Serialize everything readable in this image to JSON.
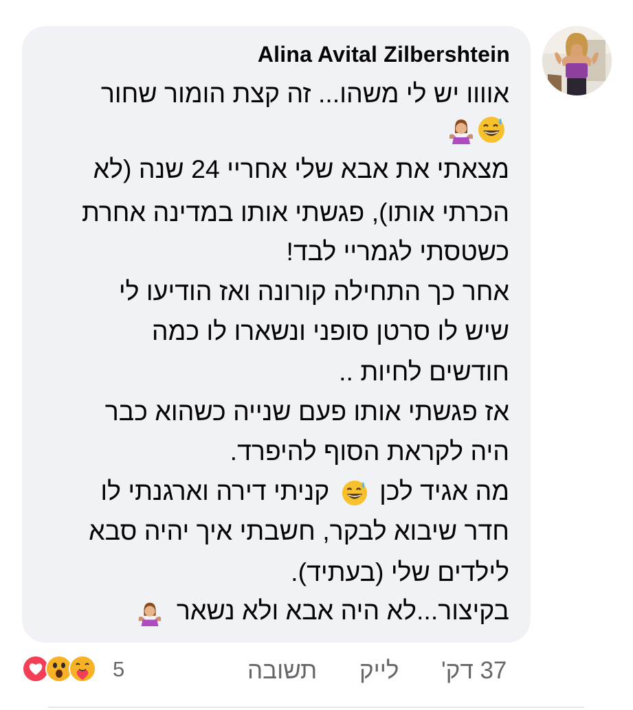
{
  "comment": {
    "author": "Alina Avital Zilbershtein",
    "lines": [
      "אוווו יש לי משהו... זה קצת הומור שחור",
      "",
      "מצאתי את אבא שלי אחריי 24 שנה (לא",
      "הכרתי אותו), פגשתי אותו במדינה אחרת",
      "כשטסתי לגמריי לבד!",
      "אחר כך התחילה קורונה ואז הודיעו לי",
      "שיש לו סרטן סופני ונשארו לו כמה",
      "חודשים לחיות ..",
      "אז פגשתי אותו פעם שנייה כשהוא כבר",
      "היה לקראת הסוף להיפרד.",
      "מה אגיד לכן",
      "קניתי דירה וארגנתי לו",
      "חדר שיבוא לבקר, חשבתי איך יהיה סבא",
      "לילדים שלי (בעתיד).",
      "בקיצור...לא היה אבא ולא נשאר"
    ],
    "emojis": [
      "grinning-sweat-emoji",
      "woman-shrugging-emoji"
    ]
  },
  "footer": {
    "time": "37 דק'",
    "like": "לייק",
    "reply": "תשובה",
    "reaction_count": "5",
    "reactions": [
      "heart-reaction-icon",
      "wow-reaction-icon",
      "care-reaction-icon"
    ]
  },
  "colors": {
    "bubble": "#f0f2f5",
    "text": "#050505",
    "secondary": "#65676b",
    "love": "#f33e58",
    "wow": "#f7b125"
  }
}
